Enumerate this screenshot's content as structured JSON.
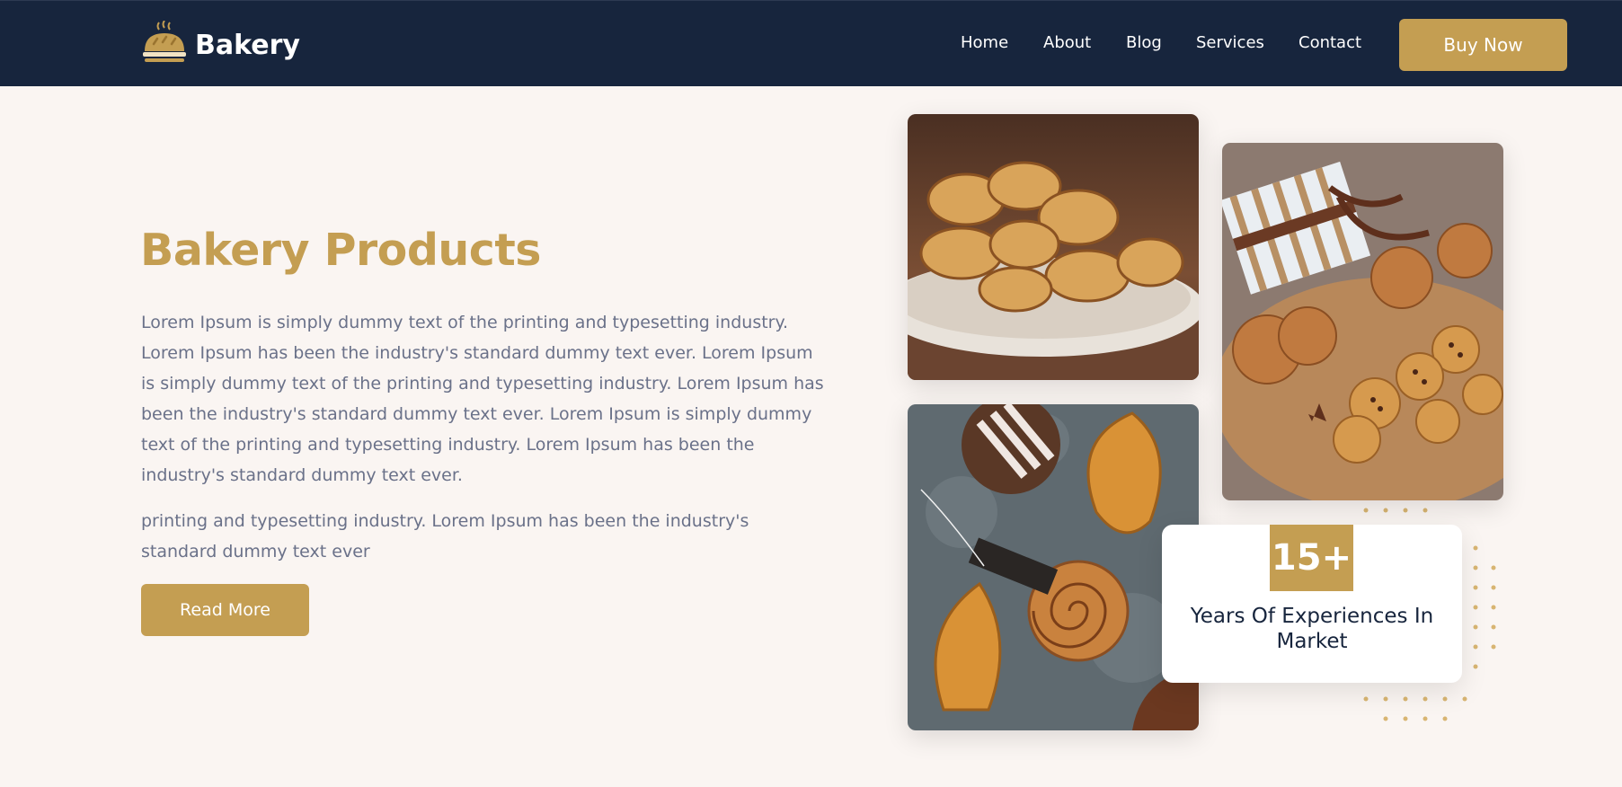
{
  "brand": {
    "name": "Bakery",
    "logo_icon": "bread-loaf-icon",
    "accent": "#c49e52",
    "header_bg": "#17253d"
  },
  "nav": {
    "items": [
      "Home",
      "About",
      "Blog",
      "Services",
      "Contact"
    ],
    "cta": "Buy Now"
  },
  "hero": {
    "title": "Bakery Products",
    "paragraph1": "Lorem Ipsum is simply dummy text of the printing and typesetting industry. Lorem Ipsum has been the industry's standard dummy text ever. Lorem Ipsum is simply dummy text of the printing and typesetting industry. Lorem Ipsum has been the industry's standard dummy text ever. Lorem Ipsum is simply dummy text of the printing and typesetting industry. Lorem Ipsum has been the industry's standard dummy text ever.",
    "paragraph2": "printing and typesetting industry. Lorem Ipsum has been the industry's standard dummy text ever",
    "button": "Read More"
  },
  "stats": {
    "value": "15+",
    "label": "Years Of Experiences In Market"
  }
}
